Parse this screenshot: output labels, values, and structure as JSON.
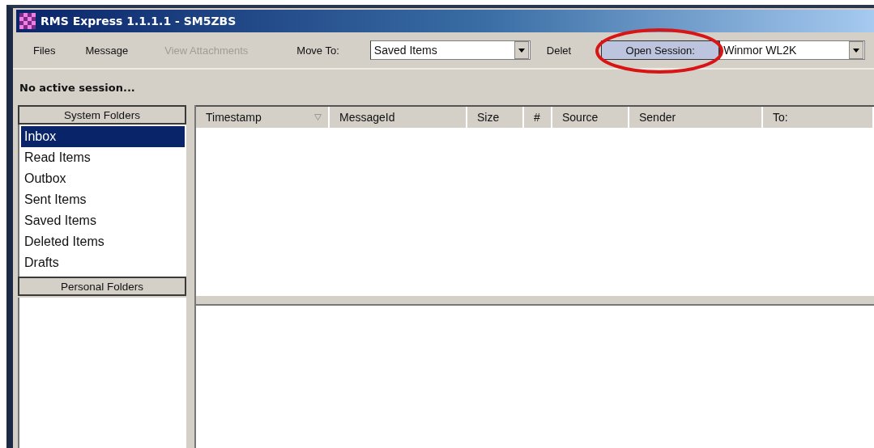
{
  "window": {
    "title": "RMS Express 1.1.1.1 - SM5ZBS"
  },
  "toolbar": {
    "menus": [
      {
        "label": "Files",
        "disabled": false
      },
      {
        "label": "Message",
        "disabled": false
      },
      {
        "label": "View Attachments",
        "disabled": true
      }
    ],
    "move_to": {
      "label": "Move To:",
      "value": "Saved Items"
    },
    "delete": {
      "label": "Delet"
    },
    "open_session": {
      "label": "Open Session:"
    },
    "mode": {
      "value": "Winmor WL2K"
    }
  },
  "status": "No active session...",
  "system_folders": {
    "header": "System Folders",
    "items": [
      {
        "label": "Inbox",
        "selected": true
      },
      {
        "label": "Read Items",
        "selected": false
      },
      {
        "label": "Outbox",
        "selected": false
      },
      {
        "label": "Sent Items",
        "selected": false
      },
      {
        "label": "Saved Items",
        "selected": false
      },
      {
        "label": "Deleted Items",
        "selected": false
      },
      {
        "label": "Drafts",
        "selected": false
      }
    ]
  },
  "personal_folders": {
    "header": "Personal Folders"
  },
  "table": {
    "columns": [
      {
        "label": "Timestamp",
        "sorted": true
      },
      {
        "label": "MessageId",
        "sorted": false
      },
      {
        "label": "Size",
        "sorted": false
      },
      {
        "label": "#",
        "sorted": false
      },
      {
        "label": "Source",
        "sorted": false
      },
      {
        "label": "Sender",
        "sorted": false
      },
      {
        "label": "To:",
        "sorted": false
      }
    ]
  }
}
